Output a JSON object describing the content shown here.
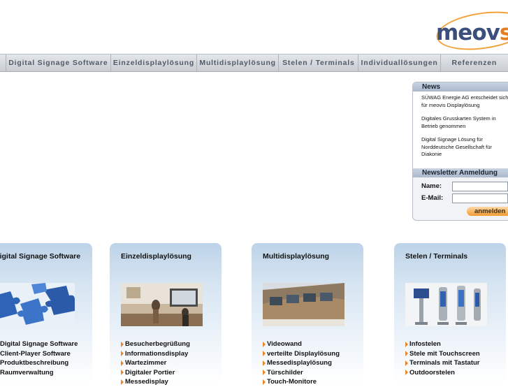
{
  "logo": {
    "text_main": "meov",
    "text_accent": "s"
  },
  "nav": {
    "items": [
      {
        "label": "Digital Signage Software"
      },
      {
        "label": "Einzeldisplaylösung"
      },
      {
        "label": "Multidisplaylösung"
      },
      {
        "label": "Stelen / Terminals"
      },
      {
        "label": "Individuallösungen"
      },
      {
        "label": "Referenzen"
      }
    ]
  },
  "news": {
    "header": "News",
    "items": [
      "SÜWAG Energie AG entscheidet sich für meovis Displaylösung",
      "Digitales Grusskarten System in Betrieb genommen",
      "Digital Signage Lösung für Norddeutsche Gesellschaft für Diakonie"
    ]
  },
  "newsletter": {
    "header": "Newsletter Anmeldung",
    "name_label": "Name:",
    "name_value": "",
    "email_label": "E-Mail:",
    "email_value": "",
    "submit_label": "anmelden"
  },
  "columns": [
    {
      "title": "Digital Signage Software",
      "items": [
        "Digital Signage Software",
        "Client-Player Software",
        "Produktbeschreibung",
        "Raumverwaltung"
      ]
    },
    {
      "title": "Einzeldisplaylösung",
      "items": [
        "Besucherbegrüßung",
        "Informationsdisplay",
        "Wartezimmer",
        "Digitaler Portier",
        "Messedisplay"
      ]
    },
    {
      "title": "Multidisplaylösung",
      "items": [
        "Videowand",
        "verteilte Displaylösung",
        "Messedisplaylösung",
        "Türschilder",
        "Touch-Monitore"
      ]
    },
    {
      "title": "Stelen / Terminals",
      "items": [
        "Infostelen",
        "Stele mit Touchscreen",
        "Terminals mit Tastatur",
        "Outdoorstelen"
      ]
    }
  ],
  "colors": {
    "accent": "#e8862a",
    "nav_text": "#505a68",
    "panel_blue": "#bdd3e8"
  }
}
